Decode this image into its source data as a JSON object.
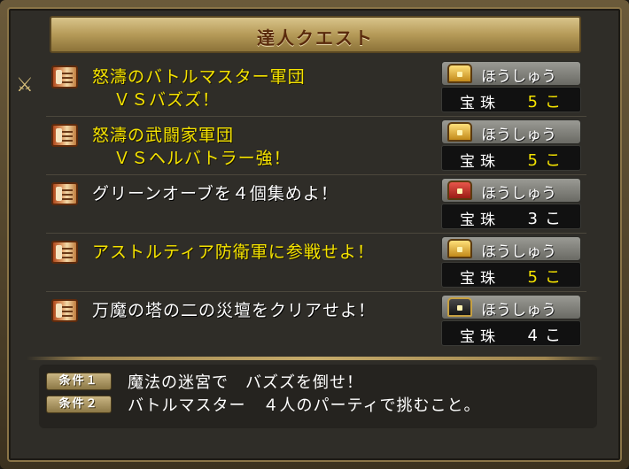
{
  "header": {
    "title": "達人クエスト"
  },
  "reward_label": "ほうしゅう",
  "reward_item": "宝珠",
  "quests": [
    {
      "line1": "怒濤のバトルマスター軍団",
      "line2": "ＶＳバズズ！",
      "count": "5こ",
      "chest": "gold",
      "highlight": true
    },
    {
      "line1": "怒濤の武闘家軍団",
      "line2": "ＶＳヘルバトラー強！",
      "count": "5こ",
      "chest": "gold",
      "highlight": true
    },
    {
      "line1": "グリーンオーブを４個集めよ！",
      "line2": "",
      "count": "3こ",
      "chest": "red",
      "highlight": false
    },
    {
      "line1": "アストルティア防衛軍に参戦せよ！",
      "line2": "",
      "count": "5こ",
      "chest": "gold",
      "highlight": true
    },
    {
      "line1": "万魔の塔の二の災壇をクリアせよ！",
      "line2": "",
      "count": "4こ",
      "chest": "black",
      "highlight": false
    }
  ],
  "conditions": [
    {
      "badge": "条件１",
      "text": "魔法の迷宮で　バズズを倒せ！"
    },
    {
      "badge": "条件２",
      "text": "バトルマスター　４人のパーティで挑むこと。"
    }
  ],
  "colors": {
    "highlight_text": "#f5e300",
    "normal_text": "#ffffff"
  },
  "icons": {
    "cursor": "sword-cursor-icon",
    "quest": "scroll-icon",
    "reward": "treasure-chest-icon"
  }
}
